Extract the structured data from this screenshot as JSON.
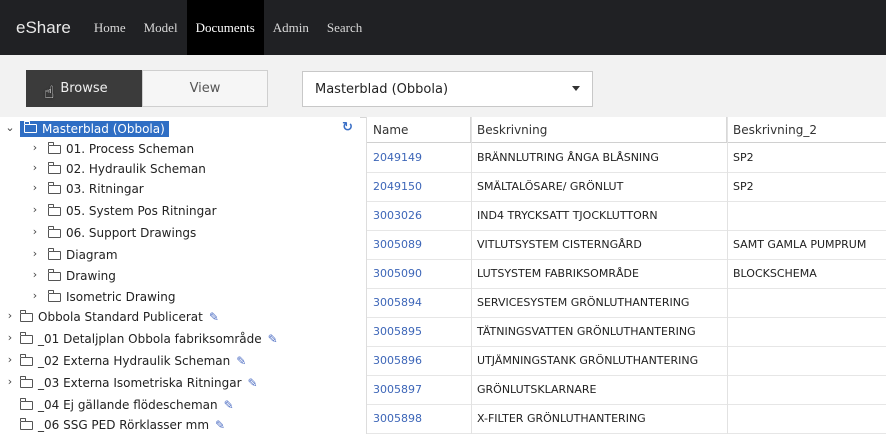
{
  "navbar": {
    "brand": "eShare",
    "items": [
      "Home",
      "Model",
      "Documents",
      "Admin",
      "Search"
    ],
    "active": "Documents"
  },
  "toolbar": {
    "browse_label": "Browse",
    "view_label": "View",
    "selected_model": "Masterblad (Obbola)"
  },
  "tree": {
    "root": "Masterblad (Obbola)",
    "children": [
      "01. Process Scheman",
      "02. Hydraulik Scheman",
      "03. Ritningar",
      "05. System Pos Ritningar",
      "06. Support Drawings",
      "Diagram",
      "Drawing",
      "Isometric Drawing"
    ],
    "siblings": [
      "Obbola Standard Publicerat",
      "_01 Detaljplan Obbola fabriksområde",
      "_02 Externa Hydraulik Scheman",
      "_03 Externa Isometriska Ritningar",
      "_04 Ej gällande flödescheman",
      "_06 SSG PED Rörklasser mm"
    ]
  },
  "table": {
    "columns": [
      "Name",
      "Beskrivning",
      "Beskrivning_2"
    ],
    "rows": [
      {
        "name": "2049149",
        "desc": "BRÄNNLUTRING ÅNGA BLÅSNING",
        "desc2": "SP2"
      },
      {
        "name": "2049150",
        "desc": "SMÄLTALÖSARE/ GRÖNLUT",
        "desc2": "SP2"
      },
      {
        "name": "3003026",
        "desc": "IND4 TRYCKSATT TJOCKLUTTORN",
        "desc2": ""
      },
      {
        "name": "3005089",
        "desc": "VITLUTSYSTEM CISTERNGÅRD",
        "desc2": "SAMT GAMLA PUMPRUM"
      },
      {
        "name": "3005090",
        "desc": "LUTSYSTEM FABRIKSOMRÅDE",
        "desc2": "BLOCKSCHEMA"
      },
      {
        "name": "3005894",
        "desc": "SERVICESYSTEM GRÖNLUTHANTERING",
        "desc2": ""
      },
      {
        "name": "3005895",
        "desc": "TÄTNINGSVATTEN GRÖNLUTHANTERING",
        "desc2": ""
      },
      {
        "name": "3005896",
        "desc": "UTJÄMNINGSTANK GRÖNLUTHANTERING",
        "desc2": ""
      },
      {
        "name": "3005897",
        "desc": "GRÖNLUTSKLARNARE",
        "desc2": ""
      },
      {
        "name": "3005898",
        "desc": "X-FILTER GRÖNLUTHANTERING",
        "desc2": ""
      }
    ]
  },
  "icons": {
    "folder": "folder-icon",
    "expand": "chevron-right-icon",
    "collapse": "chevron-down-icon",
    "edit": "pencil-icon",
    "refresh": "refresh-icon"
  },
  "colors": {
    "navbar": "#202124",
    "accent": "#2f6ec4",
    "link": "#3d66b8"
  }
}
